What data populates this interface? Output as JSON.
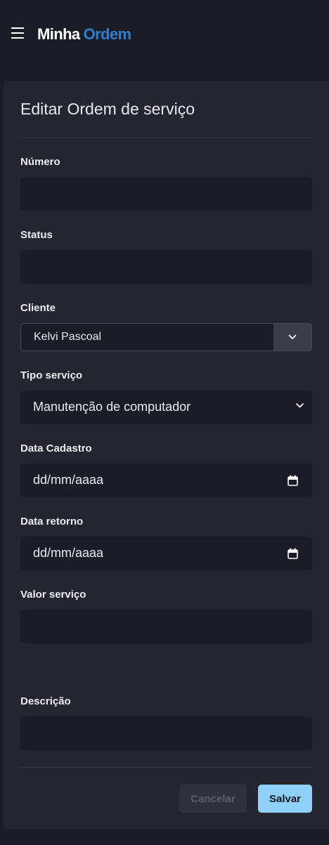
{
  "header": {
    "brand_part1": "Minha",
    "brand_part2": "Ordem",
    "brand_accent_color": "#2f80d1"
  },
  "form": {
    "title": "Editar Ordem de serviço",
    "fields": {
      "numero": {
        "label": "Número",
        "value": ""
      },
      "status": {
        "label": "Status",
        "value": ""
      },
      "cliente": {
        "label": "Cliente",
        "selected": "Kelvi Pascoal"
      },
      "tipo_servico": {
        "label": "Tipo serviço",
        "selected": "Manutenção de computador"
      },
      "data_cadastro": {
        "label": "Data Cadastro",
        "value": "dd/mm/aaaa"
      },
      "data_retorno": {
        "label": "Data retorno",
        "value": "dd/mm/aaaa"
      },
      "valor_servico": {
        "label": "Valor serviço",
        "value": ""
      },
      "descricao": {
        "label": "Descrição",
        "value": ""
      }
    },
    "buttons": {
      "cancel_label": "Cancelar",
      "save_label": "Salvar"
    }
  },
  "icons": {
    "menu": "hamburger-menu-icon",
    "dropdown": "chevron-down-icon",
    "calendar": "calendar-icon"
  },
  "colors": {
    "background": "#1b1d26",
    "card": "#24252f",
    "input": "#1b1c25",
    "save_button": "#8fd0f8",
    "cancel_button": "#2f313c"
  }
}
